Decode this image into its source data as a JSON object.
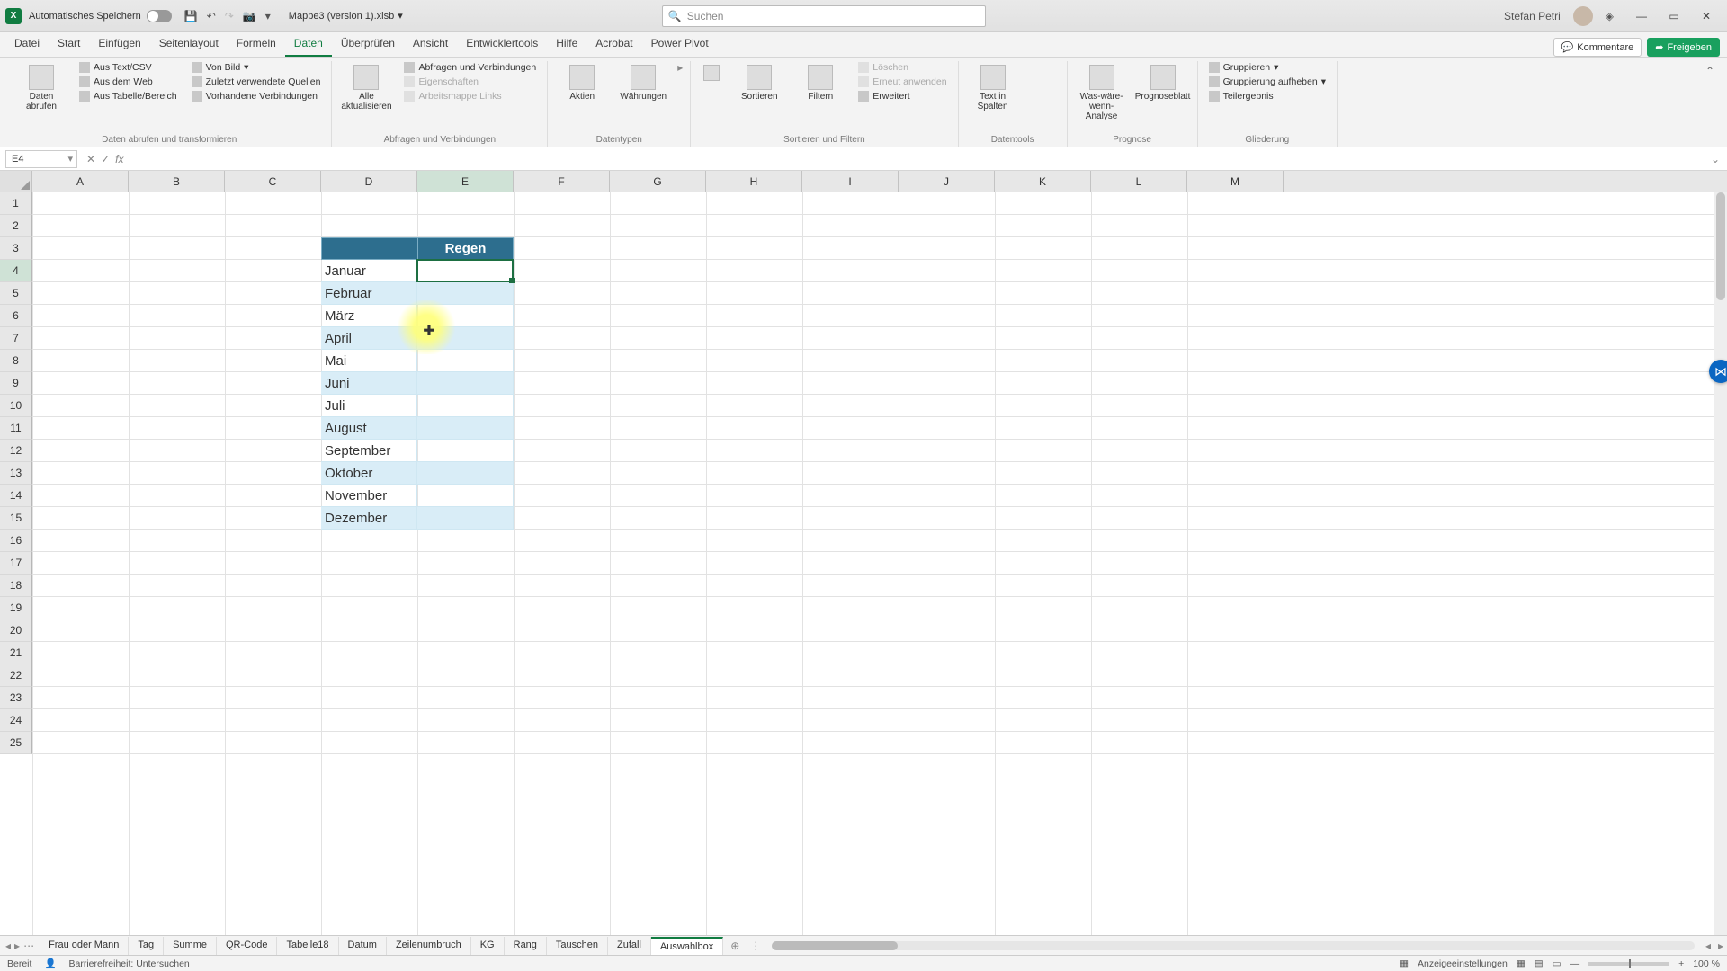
{
  "title": {
    "autosave": "Automatisches Speichern",
    "filename": "Mappe3 (version 1).xlsb",
    "search_placeholder": "Suchen",
    "username": "Stefan Petri"
  },
  "menu": {
    "tabs": [
      "Datei",
      "Start",
      "Einfügen",
      "Seitenlayout",
      "Formeln",
      "Daten",
      "Überprüfen",
      "Ansicht",
      "Entwicklertools",
      "Hilfe",
      "Acrobat",
      "Power Pivot"
    ],
    "active_index": 5,
    "comments": "Kommentare",
    "share": "Freigeben"
  },
  "ribbon": {
    "g1": {
      "big1": "Daten abrufen",
      "s1": "Aus Text/CSV",
      "s2": "Aus dem Web",
      "s3": "Aus Tabelle/Bereich",
      "s4": "Von Bild",
      "s5": "Zuletzt verwendete Quellen",
      "s6": "Vorhandene Verbindungen",
      "label": "Daten abrufen und transformieren"
    },
    "g2": {
      "big1": "Alle aktualisieren",
      "s1": "Abfragen und Verbindungen",
      "s2": "Eigenschaften",
      "s3": "Arbeitsmappe Links",
      "label": "Abfragen und Verbindungen"
    },
    "g3": {
      "b1": "Aktien",
      "b2": "Währungen",
      "label": "Datentypen"
    },
    "g4": {
      "b1": "Sortieren",
      "b2": "Filtern",
      "s1": "Löschen",
      "s2": "Erneut anwenden",
      "s3": "Erweitert",
      "label": "Sortieren und Filtern"
    },
    "g5": {
      "b1": "Text in Spalten",
      "label": "Datentools"
    },
    "g6": {
      "b1": "Was-wäre-wenn-Analyse",
      "b2": "Prognoseblatt",
      "label": "Prognose"
    },
    "g7": {
      "s1": "Gruppieren",
      "s2": "Gruppierung aufheben",
      "s3": "Teilergebnis",
      "label": "Gliederung"
    }
  },
  "fbar": {
    "cellref": "E4",
    "fx": "fx"
  },
  "grid": {
    "cols": [
      "A",
      "B",
      "C",
      "D",
      "E",
      "F",
      "G",
      "H",
      "I",
      "J",
      "K",
      "L",
      "M"
    ],
    "header_title": "Regen",
    "months": [
      "Januar",
      "Februar",
      "März",
      "April",
      "Mai",
      "Juni",
      "Juli",
      "August",
      "September",
      "Oktober",
      "November",
      "Dezember"
    ]
  },
  "sheets": {
    "tabs": [
      "Frau oder Mann",
      "Tag",
      "Summe",
      "QR-Code",
      "Tabelle18",
      "Datum",
      "Zeilenumbruch",
      "KG",
      "Rang",
      "Tauschen",
      "Zufall",
      "Auswahlbox"
    ],
    "active_index": 11
  },
  "status": {
    "ready": "Bereit",
    "accessibility": "Barrierefreiheit: Untersuchen",
    "display": "Anzeigeeinstellungen",
    "zoom": "100 %"
  }
}
